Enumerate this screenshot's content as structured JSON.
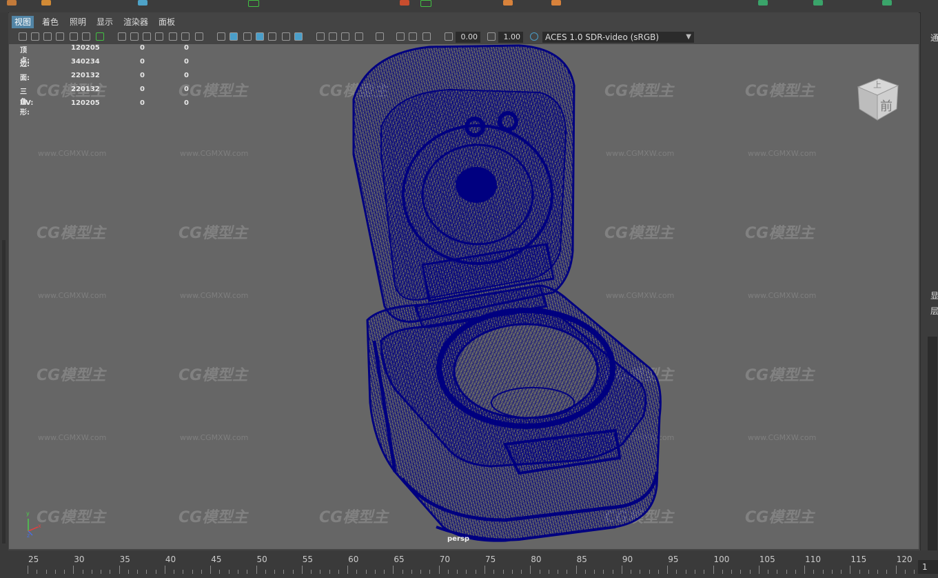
{
  "menu": {
    "items": [
      "视图",
      "着色",
      "照明",
      "显示",
      "渲染器",
      "面板"
    ],
    "active_index": 0
  },
  "toolbar": {
    "exposure_value": "0.00",
    "gamma_value": "1.00",
    "color_space": "ACES 1.0 SDR-video (sRGB)"
  },
  "hud": {
    "rows": [
      {
        "label": "顶点:",
        "count": "120205",
        "a": "0",
        "b": "0"
      },
      {
        "label": "边:",
        "count": "340234",
        "a": "0",
        "b": "0"
      },
      {
        "label": "面:",
        "count": "220132",
        "a": "0",
        "b": "0"
      },
      {
        "label": "三角形:",
        "count": "220132",
        "a": "0",
        "b": "0"
      },
      {
        "label": "UV:",
        "count": "120205",
        "a": "0",
        "b": "0"
      }
    ]
  },
  "viewcube": {
    "top_label": "上",
    "front_label": "前"
  },
  "camera_label": "persp",
  "axis": {
    "x": "x",
    "y": "y",
    "z": "z"
  },
  "watermark": {
    "logo": "CG模型主",
    "url": "www.CGMXW.com"
  },
  "right_panel": {
    "top_char": "通",
    "char_a": "显",
    "char_b": "层"
  },
  "timeline": {
    "labels": [
      "25",
      "30",
      "35",
      "40",
      "45",
      "50",
      "55",
      "60",
      "65",
      "70",
      "75",
      "80",
      "85",
      "90",
      "95",
      "100",
      "105",
      "110",
      "115",
      "120"
    ],
    "current_frame": "1"
  },
  "colors": {
    "wireframe": "#000080",
    "viewport_bg": "#666666",
    "active_menu": "#5285a6"
  }
}
